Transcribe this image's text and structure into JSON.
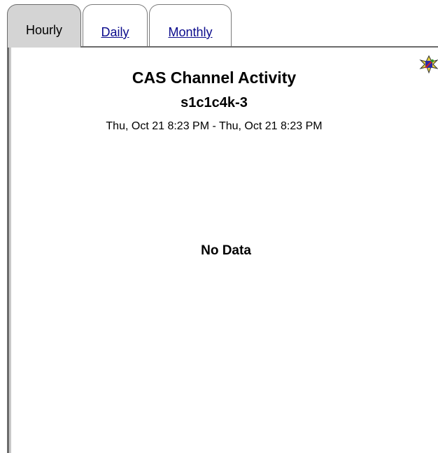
{
  "tabs": [
    {
      "label": "Hourly",
      "active": true
    },
    {
      "label": "Daily",
      "active": false
    },
    {
      "label": "Monthly",
      "active": false
    }
  ],
  "chart": {
    "title": "CAS Channel Activity",
    "subtitle": "s1c1c4k-3",
    "time_range": "Thu, Oct 21 8:23 PM - Thu, Oct 21 8:23 PM",
    "empty_message": "No Data"
  },
  "icons": {
    "corner_icon": "chart-options-icon"
  },
  "colors": {
    "link": "#0a0a8c",
    "active_tab": "#d4d4d4",
    "border": "#6b6b6b"
  }
}
